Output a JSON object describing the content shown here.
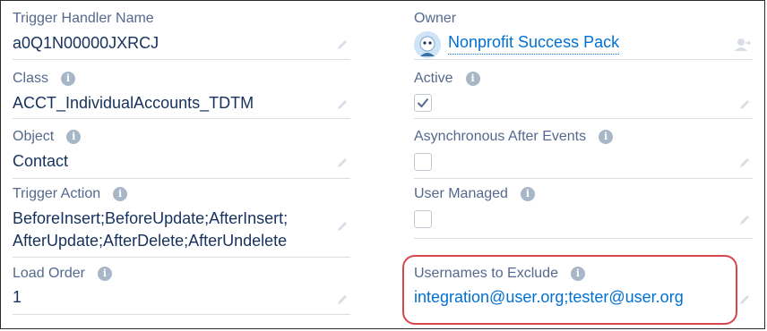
{
  "left_fields": [
    {
      "label": "Trigger Handler Name",
      "value": "a0Q1N00000JXRCJ"
    },
    {
      "label": "Class",
      "value": "ACCT_IndividualAccounts_TDTM"
    },
    {
      "label": "Object",
      "value": "Contact"
    },
    {
      "label": "Trigger Action",
      "value_line1": "BeforeInsert;BeforeUpdate;AfterInsert;",
      "value_line2": "AfterUpdate;AfterDelete;AfterUndelete"
    },
    {
      "label": "Load Order",
      "value": "1"
    }
  ],
  "right_fields": [
    {
      "label": "Owner",
      "value": "Nonprofit Success Pack"
    },
    {
      "label": "Active",
      "checked": true
    },
    {
      "label": "Asynchronous After Events",
      "checked": false
    },
    {
      "label": "User Managed",
      "checked": false
    },
    {
      "label": "Usernames to Exclude",
      "value": "integration@user.org;tester@user.org"
    }
  ],
  "info_glyph": "i",
  "icons": {
    "info": "info-icon",
    "edit": "pencil-icon",
    "change_owner": "change-owner-icon",
    "check": "checkmark-icon",
    "avatar": "astro-avatar-icon"
  },
  "colors": {
    "label": "#54698d",
    "value": "#16325c",
    "link": "#0070d2",
    "highlight": "#d9474c",
    "divider": "#d8dde6"
  }
}
